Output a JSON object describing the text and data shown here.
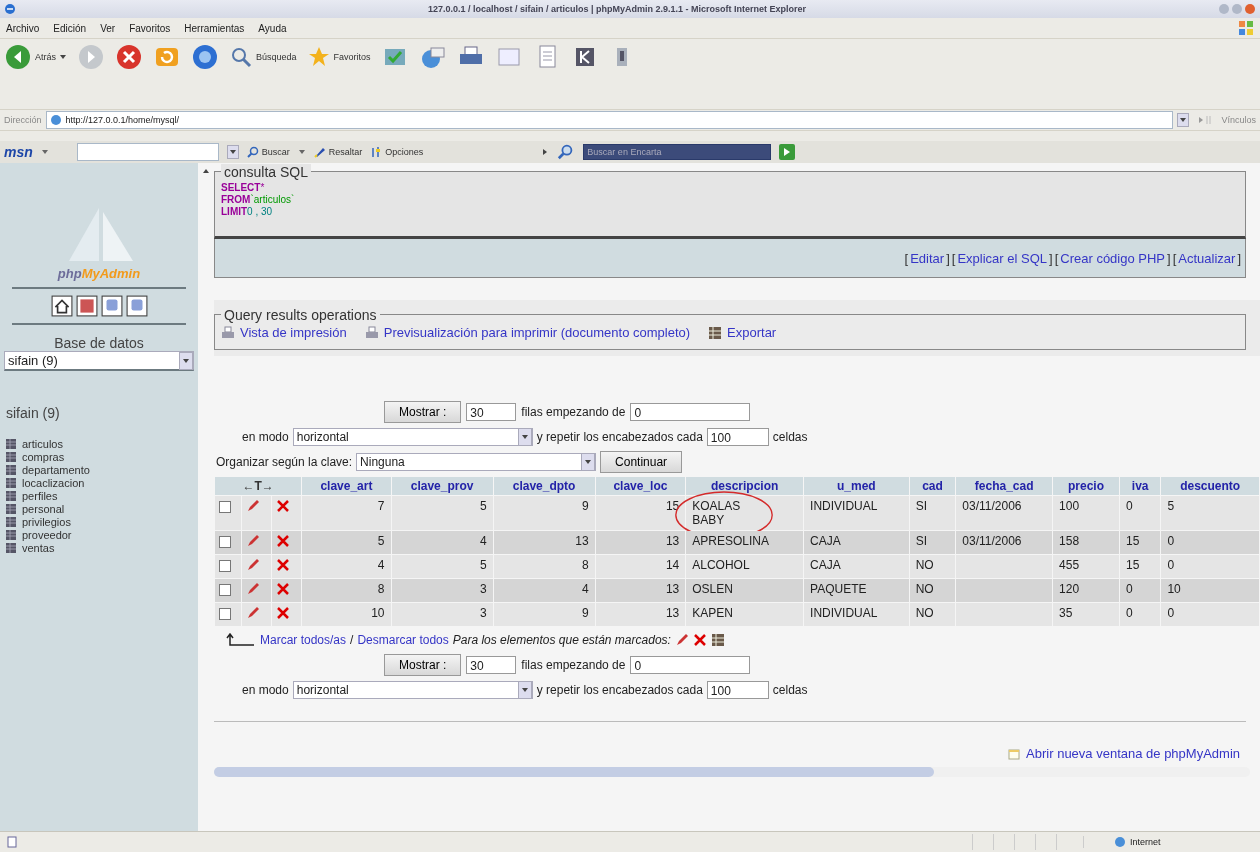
{
  "window": {
    "title": "127.0.0.1 / localhost / sifain / articulos | phpMyAdmin 2.9.1.1 - Microsoft Internet Explorer"
  },
  "menu": [
    "Archivo",
    "Edición",
    "Ver",
    "Favoritos",
    "Herramientas",
    "Ayuda"
  ],
  "toolbar": {
    "back": "Atrás",
    "search": "Búsqueda",
    "favorites": "Favoritos"
  },
  "address_bar": {
    "label": "Dirección",
    "url": "http://127.0.0.1/home/mysql/",
    "links": "Vínculos"
  },
  "msn_bar": {
    "logo": "msn",
    "search": "Buscar",
    "highlight": "Resaltar",
    "options": "Opciones",
    "placeholder": "Buscar en Encarta"
  },
  "sidebar": {
    "logo": {
      "first": "php",
      "second": "MyAdmin"
    },
    "db_label": "Base de datos",
    "db_select": "sifain (9)",
    "db_title": "sifain (9)",
    "tables": [
      "articulos",
      "compras",
      "departamento",
      "locaclizacion",
      "perfiles",
      "personal",
      "privilegios",
      "proveedor",
      "ventas"
    ]
  },
  "sql_box": {
    "legend": "consulta SQL",
    "lines": [
      [
        {
          "t": "SELECT",
          "kind": "keyword"
        },
        {
          "t": "*",
          "kind": "operator"
        }
      ],
      [
        {
          "t": "FROM",
          "kind": "keyword"
        },
        {
          "t": "`articulos`",
          "kind": "identifier"
        }
      ],
      [
        {
          "t": "LIMIT",
          "kind": "keyword"
        },
        {
          "t": "0 , 30",
          "kind": "number"
        }
      ]
    ],
    "links": [
      "Editar",
      "Explicar el SQL",
      "Crear código PHP",
      "Actualizar"
    ],
    "bracket_open": "[",
    "bracket_close": "]"
  },
  "operations": {
    "legend": "Query results operations",
    "items": [
      {
        "label": "Vista de impresión",
        "kind": "print"
      },
      {
        "label": "Previsualización para imprimir (documento completo)",
        "kind": "print"
      },
      {
        "label": "Exportar",
        "kind": "export"
      }
    ]
  },
  "navigation_top": {
    "show_button": "Mostrar :",
    "rows": "30",
    "start_label": "filas empezando de",
    "start": "0",
    "mode_label": "en modo",
    "mode": "horizontal",
    "repeat_label": "y repetir los encabezados cada",
    "repeat": "100",
    "cells_label": "celdas"
  },
  "sort": {
    "label": "Organizar según la clave:",
    "value": "Ninguna",
    "button": "Continuar"
  },
  "table": {
    "arrows": "←T→",
    "columns": [
      "clave_art",
      "clave_prov",
      "clave_dpto",
      "clave_loc",
      "descripcion",
      "u_med",
      "cad",
      "fecha_cad",
      "precio",
      "iva",
      "descuento"
    ],
    "rows": [
      {
        "checked": false,
        "circled": true,
        "cells": [
          "7",
          "5",
          "9",
          "15",
          "KOALAS BABY",
          "INDIVIDUAL",
          "SI",
          "03/11/2006",
          "100",
          "0",
          "5"
        ]
      },
      {
        "checked": false,
        "circled": false,
        "cells": [
          "5",
          "4",
          "13",
          "13",
          "APRESOLINA",
          "CAJA",
          "SI",
          "03/11/2006",
          "158",
          "15",
          "0"
        ]
      },
      {
        "checked": false,
        "circled": false,
        "cells": [
          "4",
          "5",
          "8",
          "14",
          "ALCOHOL",
          "CAJA",
          "NO",
          "",
          "455",
          "15",
          "0"
        ]
      },
      {
        "checked": false,
        "circled": false,
        "cells": [
          "8",
          "3",
          "4",
          "13",
          "OSLEN",
          "PAQUETE",
          "NO",
          "",
          "120",
          "0",
          "10"
        ]
      },
      {
        "checked": false,
        "circled": false,
        "cells": [
          "10",
          "3",
          "9",
          "13",
          "KAPEN",
          "INDIVIDUAL",
          "NO",
          "",
          "35",
          "0",
          "0"
        ]
      }
    ]
  },
  "table_footer": {
    "check_all": "Marcar todos/as",
    "separator": "/",
    "uncheck_all": "Desmarcar todos",
    "with_selected": "Para los elementos que están marcados:"
  },
  "navigation_bottom": {
    "show_button": "Mostrar :",
    "rows": "30",
    "start_label": "filas empezando de",
    "start": "0",
    "mode_label": "en modo",
    "mode": "horizontal",
    "repeat_label": "y repetir los encabezados cada",
    "repeat": "100",
    "cells_label": "celdas"
  },
  "new_window_link": "Abrir nueva ventana de phpMyAdmin",
  "status_bar": {
    "zone": "Internet"
  }
}
